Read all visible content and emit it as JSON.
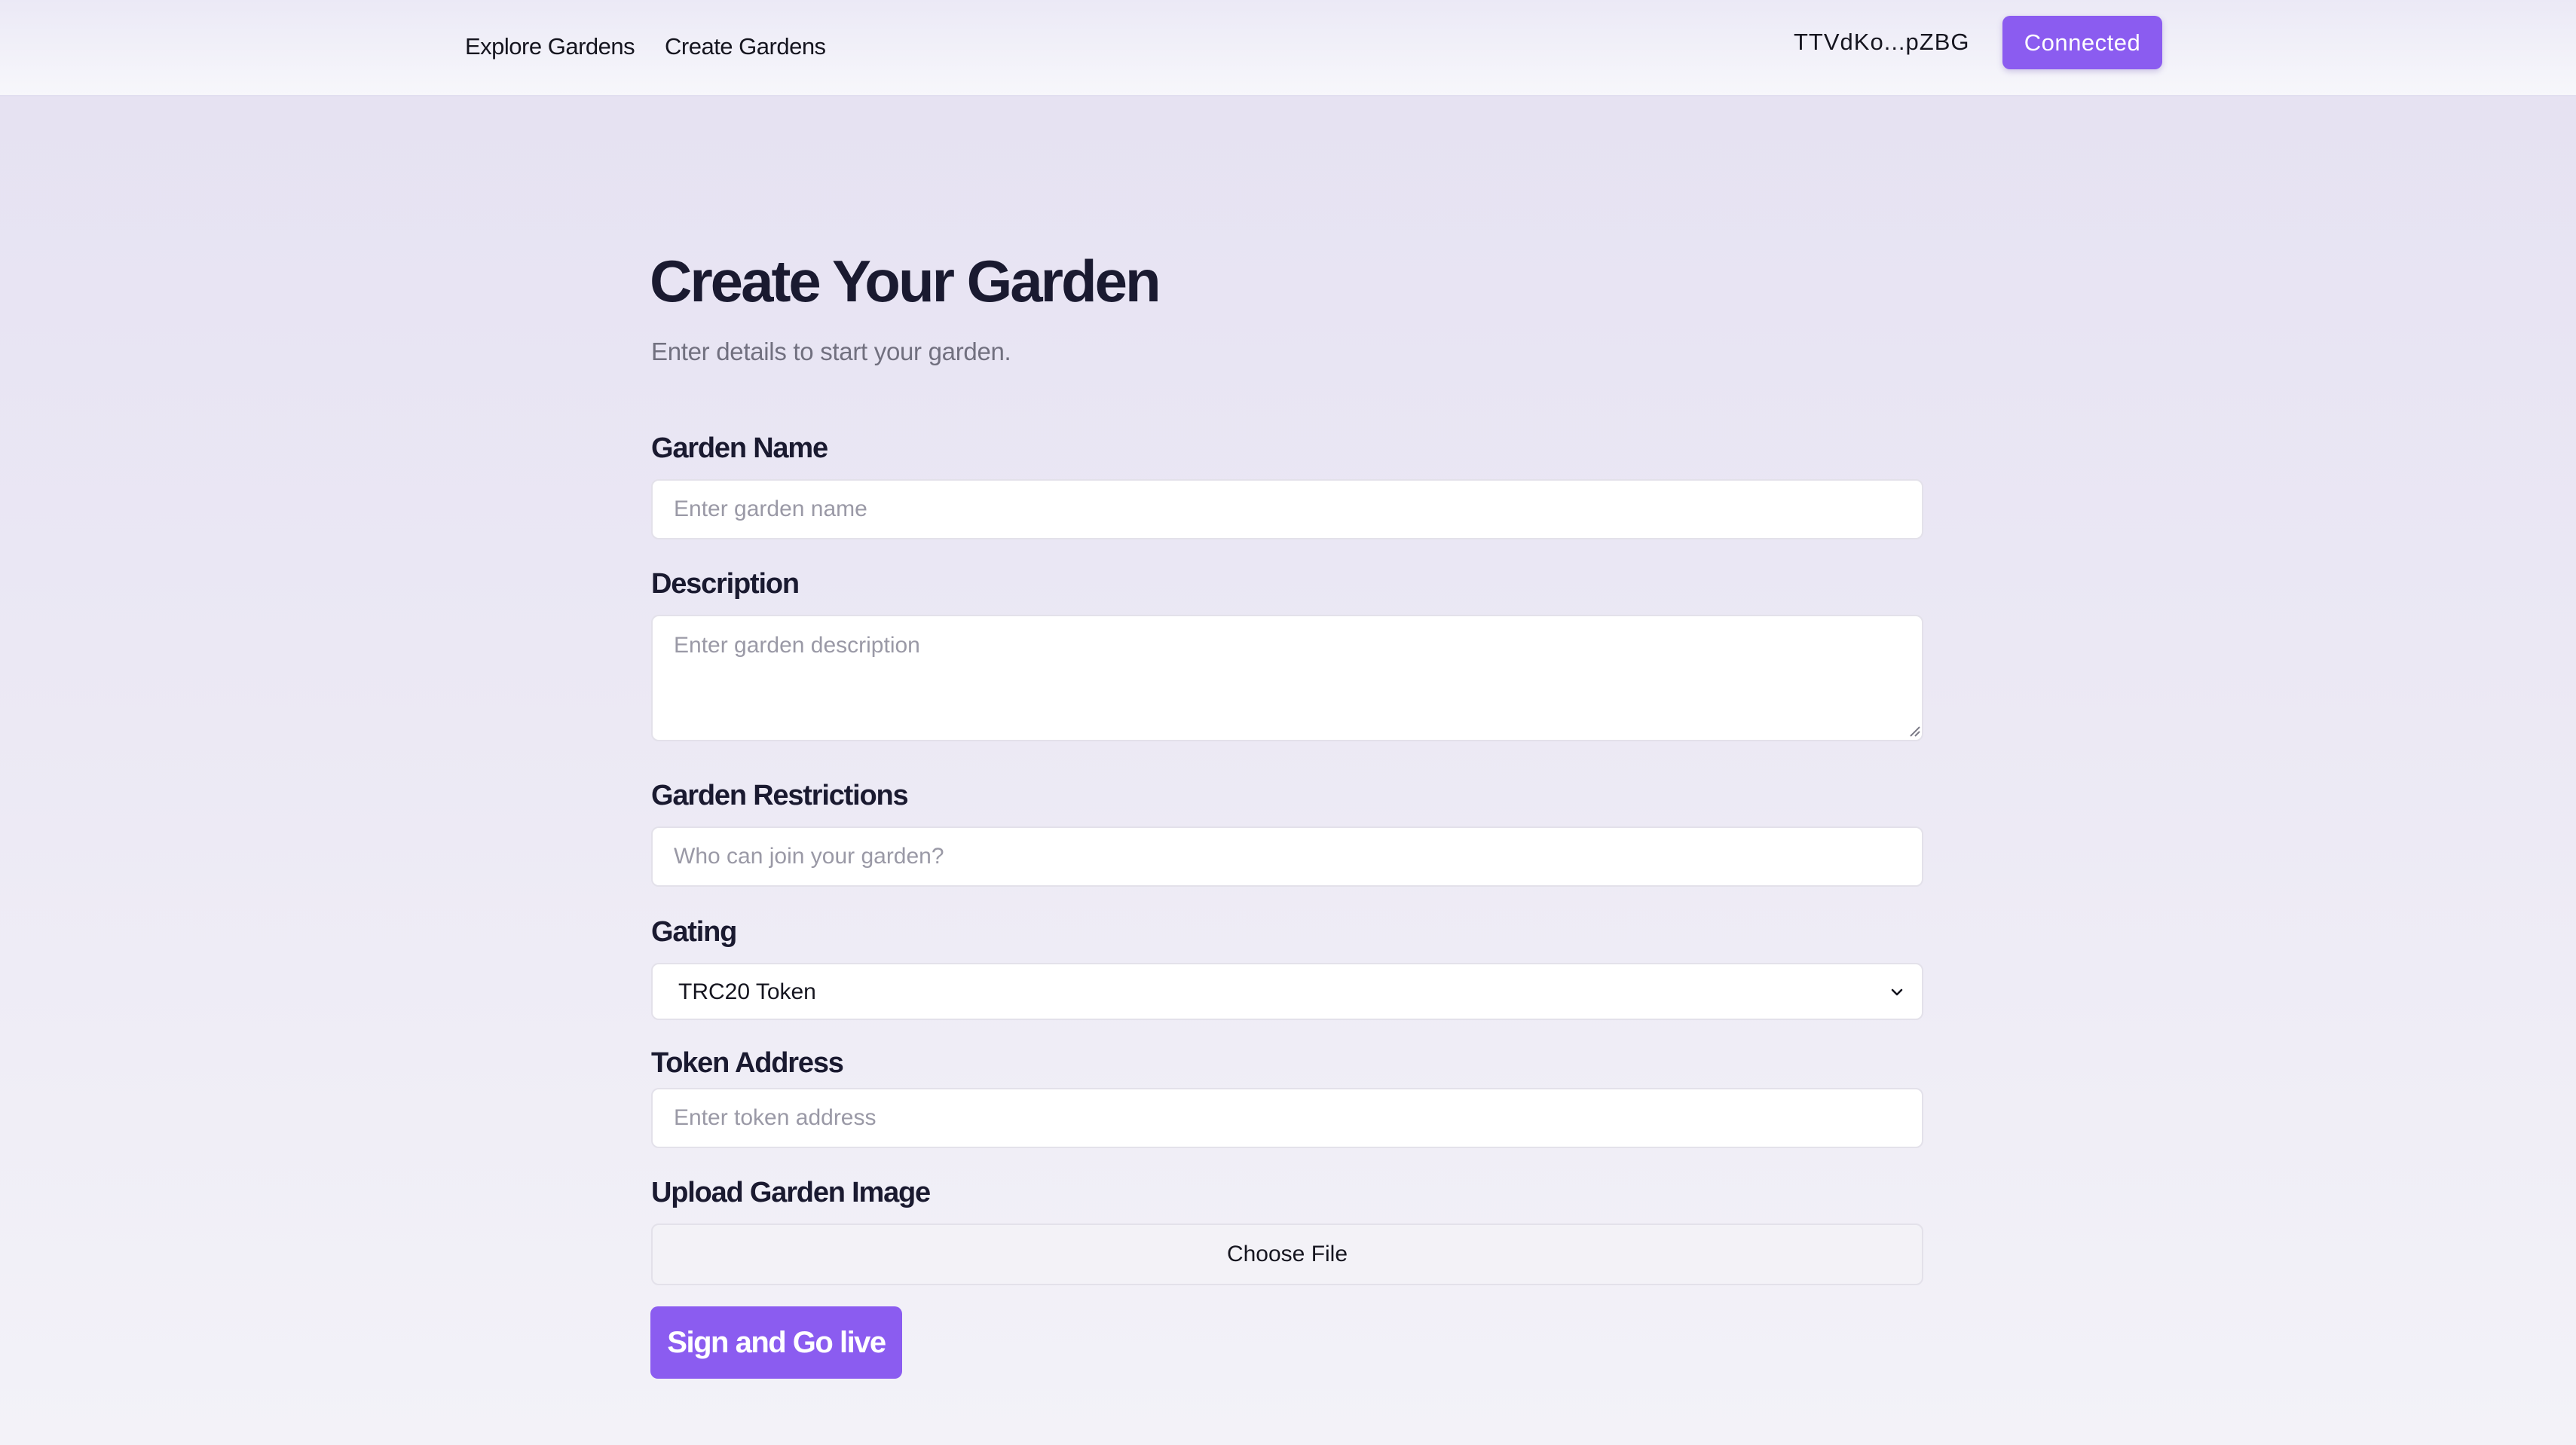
{
  "nav": {
    "explore_label": "Explore Gardens",
    "create_label": "Create Gardens"
  },
  "wallet": {
    "address": "TTVdKo...pZBG",
    "status_label": "Connected"
  },
  "form": {
    "title": "Create Your Garden",
    "subtitle": "Enter details to start your garden.",
    "garden_name": {
      "label": "Garden Name",
      "value": "",
      "placeholder": "Enter garden name"
    },
    "description": {
      "label": "Description",
      "value": "",
      "placeholder": "Enter garden description"
    },
    "restrictions": {
      "label": "Garden Restrictions",
      "value": "",
      "placeholder": "Who can join your garden?"
    },
    "gating": {
      "label": "Gating",
      "selected": "TRC20 Token",
      "icon": "chevron-down-icon"
    },
    "token_address": {
      "label": "Token Address",
      "value": "",
      "placeholder": "Enter token address"
    },
    "image_upload": {
      "label": "Upload Garden Image",
      "button_label": "Choose File"
    },
    "submit_label": "Sign and Go live"
  },
  "colors": {
    "accent": "#8b5cf0",
    "text": "#1a1a30",
    "muted": "#71707f"
  }
}
